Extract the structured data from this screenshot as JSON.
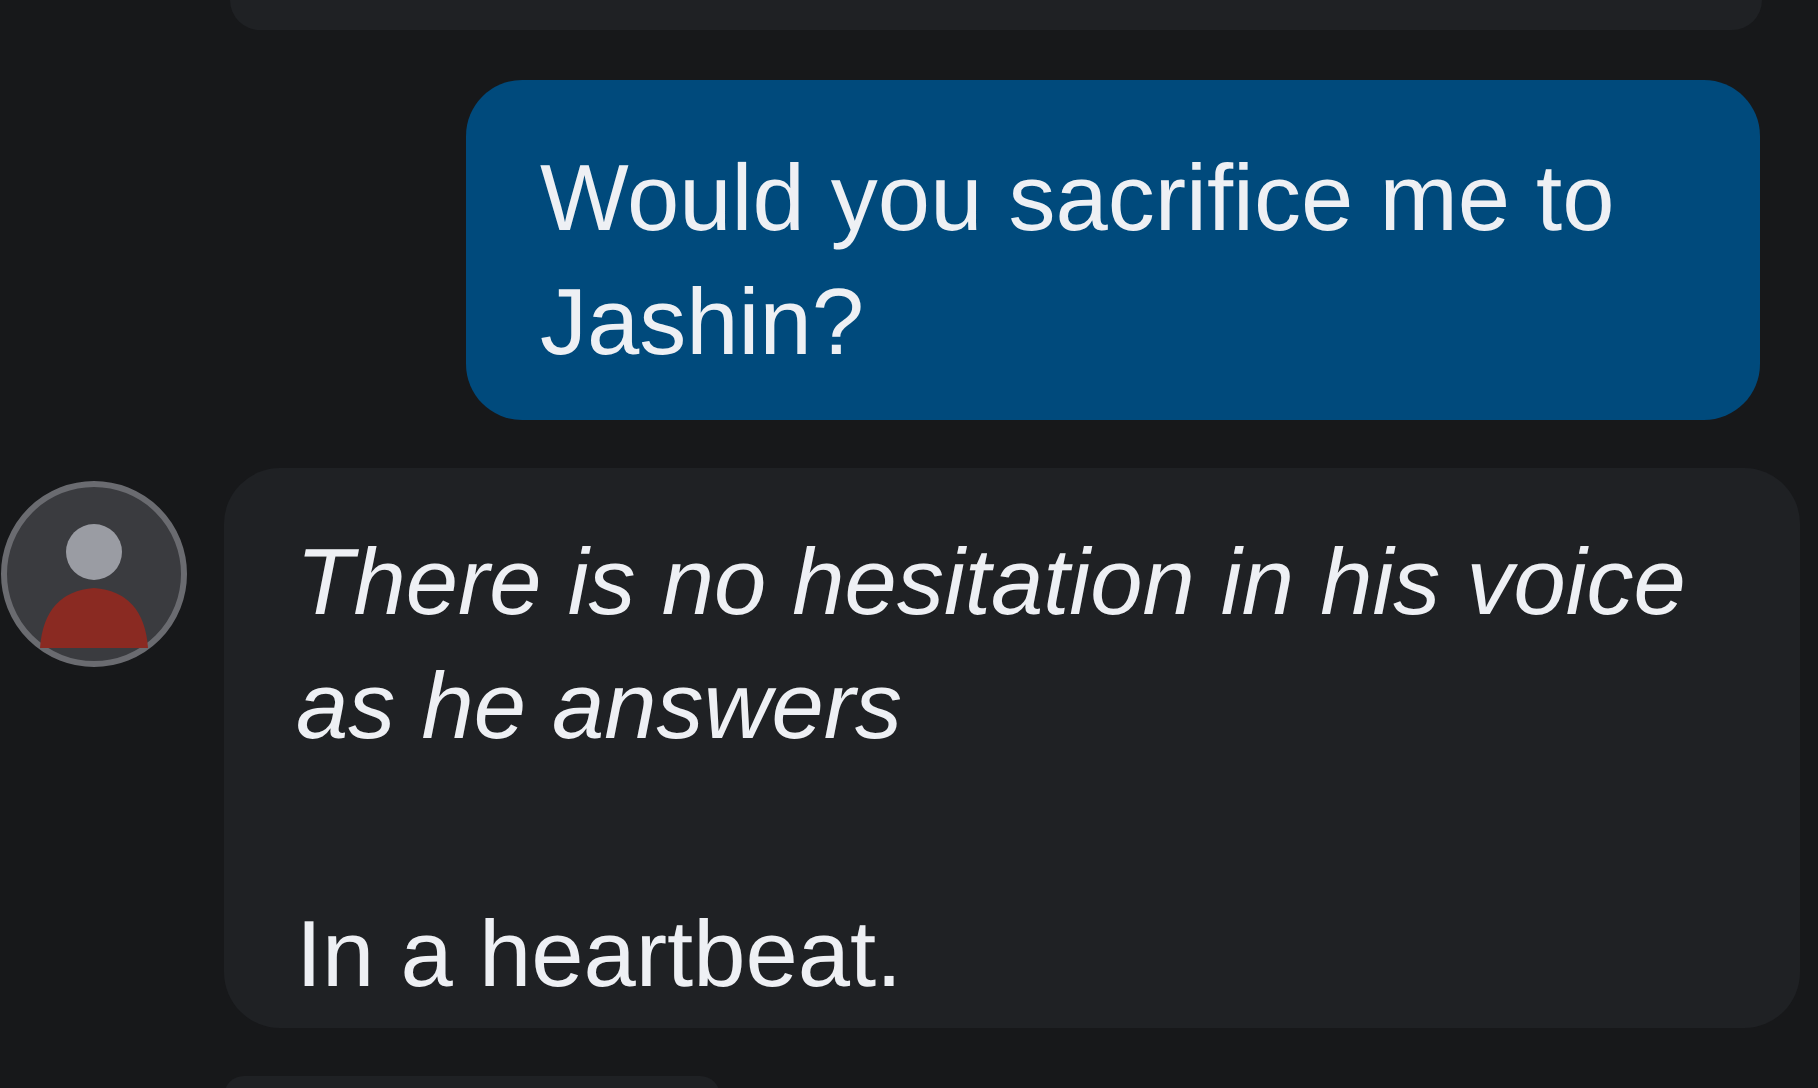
{
  "messages": [
    {
      "kind": "sent",
      "text": "Would you sacrifice me to Jashin?"
    },
    {
      "kind": "received",
      "text": "*There is no hesitation in his voice as he answers*\n\nIn a heartbeat."
    }
  ]
}
